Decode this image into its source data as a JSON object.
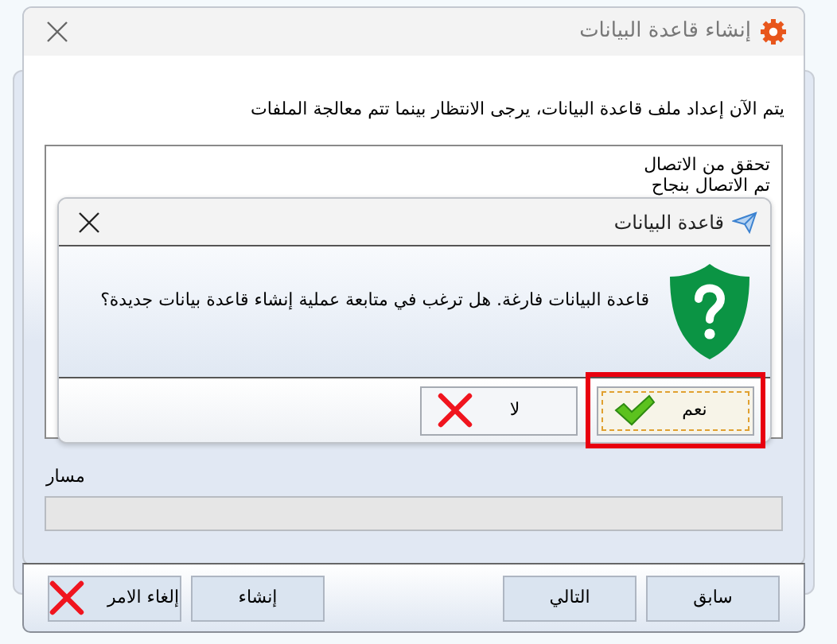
{
  "main_window": {
    "title": "إنشاء قاعدة البيانات",
    "instruction": "يتم الآن إعداد ملف قاعدة البيانات، يرجى الانتظار بينما تتم معالجة الملفات",
    "log_lines": [
      "تحقق من الاتصال",
      "تم الاتصال بنجاح"
    ],
    "path_label": "مسار",
    "buttons": [
      {
        "label": "سابق",
        "kind": "plain"
      },
      {
        "label": "التالي",
        "kind": "plain"
      },
      {
        "label": "إنشاء",
        "kind": "plain"
      },
      {
        "label": "إلغاء الامر",
        "kind": "cancel"
      }
    ]
  },
  "message_box": {
    "title": "قاعدة البيانات",
    "message": "قاعدة البيانات فارغة. هل ترغب في متابعة عملية إنشاء قاعدة بيانات جديدة؟",
    "buttons": [
      {
        "label": "نعم",
        "kind": "yes",
        "focused": true,
        "highlighted": true
      },
      {
        "label": "لا",
        "kind": "no",
        "focused": false,
        "highlighted": false
      }
    ]
  }
}
